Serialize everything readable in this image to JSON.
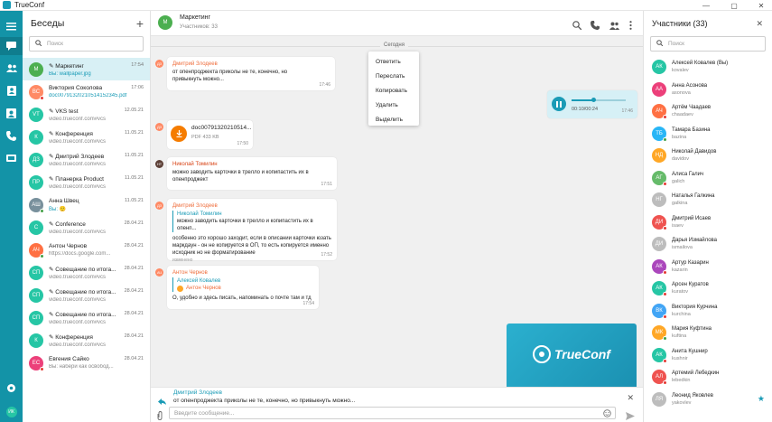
{
  "app": {
    "title": "TrueConf",
    "brand_color": "#1393a7"
  },
  "window_controls": [
    "minimize-icon",
    "maximize-icon",
    "close-icon"
  ],
  "rail": {
    "icons": [
      "menu-icon",
      "chat-icon",
      "contacts-icon",
      "address-book-icon",
      "conference-icon",
      "phone-icon",
      "tv-icon",
      "settings-icon",
      "user-icon"
    ],
    "user_avatar": "ИК"
  },
  "conversations": {
    "title": "Беседы",
    "add_label": "+",
    "search_placeholder": "Поиск",
    "items": [
      {
        "initials": "M",
        "name": "✎ Маркетинг",
        "sub": "Вы: wallpaper.jpg",
        "date": "17:54",
        "color": "#4caf50",
        "dot": "",
        "sub_blue": true,
        "selected": true
      },
      {
        "initials": "ВС",
        "name": "Виктория Соколова",
        "sub": "doc00791320210514152345.pdf",
        "date": "17:06",
        "color": "#ff8a65",
        "dot": "#e53935",
        "sub_blue": true
      },
      {
        "initials": "VT",
        "name": "✎ VKS test",
        "sub": "video.trueconf.com#vcs",
        "date": "12.05.21",
        "color": "#26c6a5",
        "dot": ""
      },
      {
        "initials": "К",
        "name": "✎ Конференция",
        "sub": "video.trueconf.com#vcs",
        "date": "11.05.21",
        "color": "#26c6a5",
        "dot": ""
      },
      {
        "initials": "ДЗ",
        "name": "✎ Дмитрий Злодеев",
        "sub": "video.trueconf.com#vcs",
        "date": "11.05.21",
        "color": "#26c6a5",
        "dot": ""
      },
      {
        "initials": "ПР",
        "name": "✎ Планерка Product",
        "sub": "video.trueconf.com#vcs",
        "date": "11.05.21",
        "color": "#26c6a5",
        "dot": ""
      },
      {
        "initials": "АШ",
        "name": "Анна Швец",
        "sub": "Вы: 🙂",
        "date": "11.05.21",
        "color": "#78909c",
        "dot": "#43a047",
        "sub_blue": true
      },
      {
        "initials": "C",
        "name": "✎ Conference",
        "sub": "video.trueconf.com#vcs",
        "date": "28.04.21",
        "color": "#26c6a5",
        "dot": ""
      },
      {
        "initials": "АЧ",
        "name": "Антон Чернов",
        "sub": "https://docs.google.com...",
        "date": "28.04.21",
        "color": "#ff7043",
        "dot": "#43a047"
      },
      {
        "initials": "СП",
        "name": "✎ Совещание по итога...",
        "sub": "video.trueconf.com#vcs",
        "date": "28.04.21",
        "color": "#26c6a5",
        "dot": ""
      },
      {
        "initials": "СП",
        "name": "✎ Совещание по итога...",
        "sub": "video.trueconf.com#vcs",
        "date": "28.04.21",
        "color": "#26c6a5",
        "dot": ""
      },
      {
        "initials": "СП",
        "name": "✎ Совещание по итога...",
        "sub": "video.trueconf.com#vcs",
        "date": "28.04.21",
        "color": "#26c6a5",
        "dot": ""
      },
      {
        "initials": "К",
        "name": "✎ Конференция",
        "sub": "video.trueconf.com#vcs",
        "date": "28.04.21",
        "color": "#26c6a5",
        "dot": ""
      },
      {
        "initials": "ЕС",
        "name": "Евгения Сайко",
        "sub": "Вы: набери как освобод...",
        "date": "28.04.21",
        "color": "#ec407a",
        "dot": "#e53935"
      }
    ]
  },
  "chat": {
    "title": "Маркетинг",
    "subtitle": "Участников: 33",
    "header_avatar": "M",
    "date_label": "Сегодня",
    "messages": {
      "m1": {
        "author": "Дмитрий Злодеев",
        "text": "от опенпроджекта приколы не те, конечно, но привыкнуть можно...",
        "time": "17:46",
        "avatar": "ДЗ"
      },
      "voice": {
        "duration": "00:10/00:24",
        "time": "17:46"
      },
      "file": {
        "name": "doc00791320210514...",
        "size": "PDF 433 KB",
        "time": "17:50"
      },
      "m3": {
        "author": "Николай Томилин",
        "text": "можно заводить карточки в трелло и копипастить их в опенпроджект",
        "time": "17:51"
      },
      "m4": {
        "author": "Дмитрий Злодеев",
        "quote_author": "Николай Томилин",
        "quote_text": "можно заводить карточки в трелло и копипастить их в опенп...",
        "text": "особенно это хорошо заходит, если в описании карточки юзать маркдаун - он не копируется в ОП, то есть копируется именно исходник но не форматирование",
        "edited": "изменено",
        "time": "17:52"
      },
      "m5": {
        "author": "Антон Чернов",
        "quote_author": "Алексей Ковалев",
        "quote_inner_author": "Антон Чернов",
        "text": "О, удобно и здесь писать, напоминать о почте там и тд",
        "time": "17:54",
        "avatar": "АЧ"
      }
    },
    "context_menu": [
      "Ответить",
      "Переслать",
      "Копировать",
      "Удалить",
      "Выделить"
    ],
    "image_brand": "TrueConf",
    "reply": {
      "author": "Дмитрий Злодеев",
      "text": "от опенпроджекта приколы не те, конечно, но привыкнуть можно..."
    },
    "composer_placeholder": "Введите сообщение..."
  },
  "participants": {
    "title": "Участники (33)",
    "search_placeholder": "Поиск",
    "items": [
      {
        "initials": "АК",
        "name": "Алексей Ковалев (Вы)",
        "login": "kovalev",
        "color": "#26c6a5",
        "dot": ""
      },
      {
        "initials": "АА",
        "name": "Анна Асонова",
        "login": "asonova",
        "color": "#ec407a",
        "dot": ""
      },
      {
        "initials": "АЧ",
        "name": "Артём Чаадаев",
        "login": "chaadaev",
        "color": "#ff7043",
        "dot": "#e53935"
      },
      {
        "initials": "ТБ",
        "name": "Тамара Базина",
        "login": "bazina",
        "color": "#29b6f6",
        "dot": "#43a047"
      },
      {
        "initials": "НД",
        "name": "Николай Давидов",
        "login": "davidov",
        "color": "#ffa726",
        "dot": ""
      },
      {
        "initials": "АГ",
        "name": "Алиса Галич",
        "login": "galich",
        "color": "#66bb6a",
        "dot": "#e53935"
      },
      {
        "initials": "НГ",
        "name": "Наталья Галкина",
        "login": "galkina",
        "color": "#bdbdbd",
        "dot": ""
      },
      {
        "initials": "ДИ",
        "name": "Дмитрий Исаев",
        "login": "isaev",
        "color": "#ef5350",
        "dot": "#e53935"
      },
      {
        "initials": "ДИ",
        "name": "Дарья Измайлова",
        "login": "ismailova",
        "color": "#bdbdbd",
        "dot": ""
      },
      {
        "initials": "АК",
        "name": "Артур Казарин",
        "login": "kazarin",
        "color": "#ab47bc",
        "dot": "#e53935"
      },
      {
        "initials": "АК",
        "name": "Арсен Куратов",
        "login": "kuratov",
        "color": "#26c6a5",
        "dot": "#e53935"
      },
      {
        "initials": "ВК",
        "name": "Виктория Курчина",
        "login": "kurchina",
        "color": "#42a5f5",
        "dot": "#e53935"
      },
      {
        "initials": "МК",
        "name": "Мария Куфтина",
        "login": "kuftina",
        "color": "#ffa726",
        "dot": "#43a047"
      },
      {
        "initials": "АК",
        "name": "Анита Кушнир",
        "login": "kushnir",
        "color": "#26c6a5",
        "dot": "#e53935"
      },
      {
        "initials": "АЛ",
        "name": "Артемий Лебедкин",
        "login": "lebedkin",
        "color": "#ef5350",
        "dot": "#e53935"
      },
      {
        "initials": "ЛЯ",
        "name": "Леонид Яковлев",
        "login": "yakovlev",
        "color": "#bdbdbd",
        "dot": "",
        "star": true
      }
    ]
  }
}
